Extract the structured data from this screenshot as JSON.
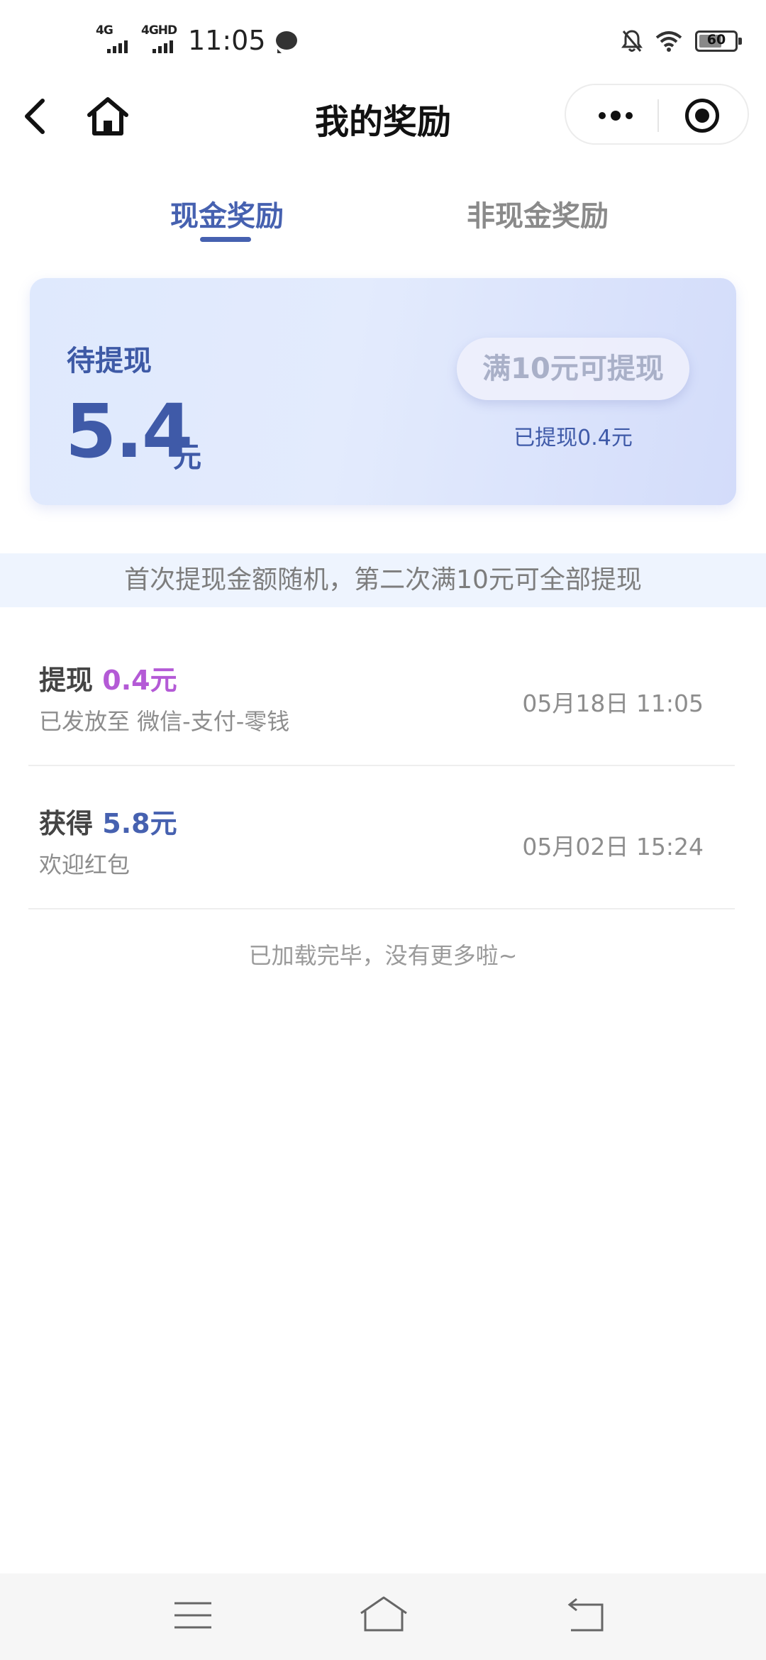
{
  "status_bar": {
    "network1": "4G",
    "network2": "4GHD",
    "time": "11:05",
    "battery": "60",
    "icons": [
      "signal-icon",
      "chat-bubble-icon",
      "bell-muted-icon",
      "wifi-icon",
      "battery-icon"
    ]
  },
  "nav": {
    "title": "我的奖励",
    "icons": [
      "back-arrow-icon",
      "home-icon",
      "more-dots-icon",
      "close-target-icon"
    ]
  },
  "tabs": [
    {
      "label": "现金奖励",
      "active": true
    },
    {
      "label": "非现金奖励",
      "active": false
    }
  ],
  "card": {
    "label": "待提现",
    "amount": "5.4",
    "unit": "元",
    "button_label": "满10元可提现",
    "withdrawn_text": "已提现0.4元"
  },
  "notice": "首次提现金额随机，第二次满10元可全部提现",
  "records": [
    {
      "action": "提现",
      "amount": "0.4元",
      "subtitle": "已发放至 微信-支付-零钱",
      "time": "05月18日 11:05"
    },
    {
      "action": "获得",
      "amount": "5.8元",
      "subtitle": "欢迎红包",
      "time": "05月02日 15:24"
    }
  ],
  "end_note": "已加载完毕，没有更多啦~",
  "colors": {
    "accent": "#4661b0",
    "withdraw_amount": "#b45ad6",
    "notice_bg": "#eef4fe"
  }
}
